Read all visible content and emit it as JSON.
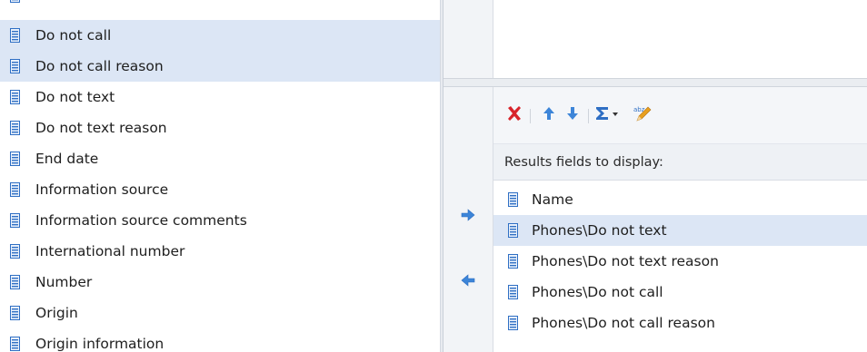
{
  "left_list": {
    "items": [
      {
        "label": "Do not call",
        "selected": true
      },
      {
        "label": "Do not call reason",
        "selected": true
      },
      {
        "label": "Do not text",
        "selected": false
      },
      {
        "label": "Do not text reason",
        "selected": false
      },
      {
        "label": "End date",
        "selected": false
      },
      {
        "label": "Information source",
        "selected": false
      },
      {
        "label": "Information source comments",
        "selected": false
      },
      {
        "label": "International number",
        "selected": false
      },
      {
        "label": "Number",
        "selected": false
      },
      {
        "label": "Origin",
        "selected": false
      },
      {
        "label": "Origin information",
        "selected": false
      }
    ]
  },
  "toolbar": {
    "delete_icon": "delete-x-icon",
    "move_up_icon": "move-up-arrow-icon",
    "move_down_icon": "move-down-arrow-icon",
    "summarize_icon": "sigma-dropdown-icon",
    "rename_icon": "abc-pencil-rename-icon"
  },
  "results": {
    "header": "Results fields to display:",
    "items": [
      {
        "label": "Name",
        "selected": false
      },
      {
        "label": "Phones\\Do not text",
        "selected": true
      },
      {
        "label": "Phones\\Do not text reason",
        "selected": false
      },
      {
        "label": "Phones\\Do not call",
        "selected": false
      },
      {
        "label": "Phones\\Do not call reason",
        "selected": false
      }
    ]
  },
  "colors": {
    "selection": "#dce6f5",
    "icon_blue": "#2f6fc4",
    "delete_red": "#d8242b",
    "arrow_blue": "#3d85d8"
  }
}
